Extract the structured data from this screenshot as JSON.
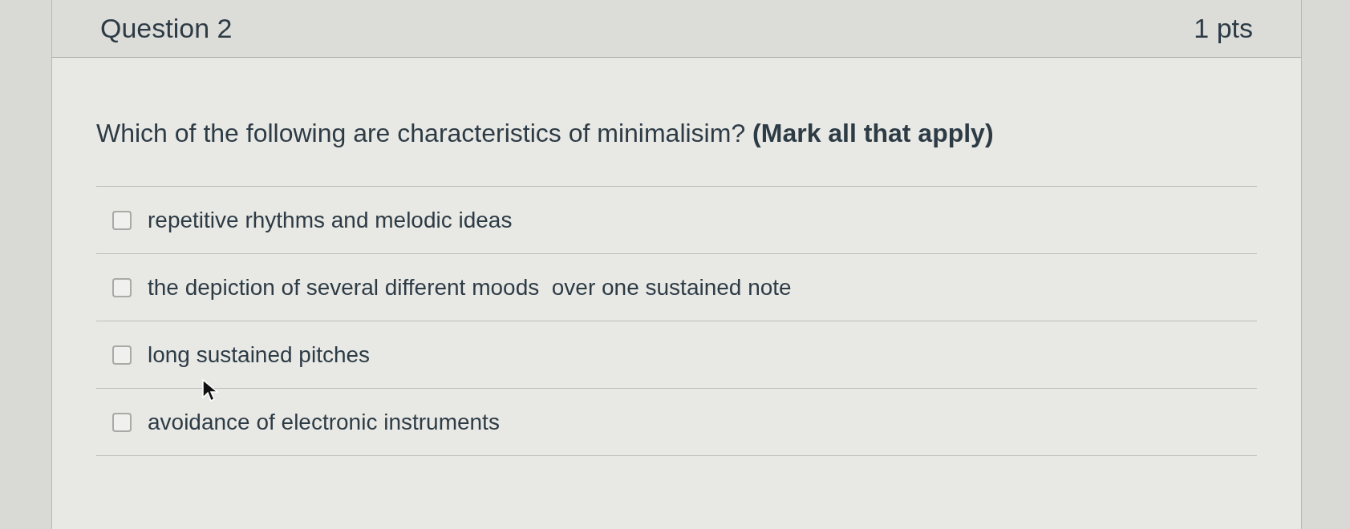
{
  "question": {
    "title": "Question 2",
    "points": "1 pts",
    "text": "Which of the following are characteristics of minimalisim? **(Mark all that apply)**"
  },
  "options": [
    {
      "label": "repetitive rhythms and melodic ideas",
      "checked": false
    },
    {
      "label": "the depiction of several different moods  over one sustained note",
      "checked": false
    },
    {
      "label": "long sustained pitches",
      "checked": false
    },
    {
      "label": "avoidance of electronic instruments",
      "checked": false
    }
  ]
}
